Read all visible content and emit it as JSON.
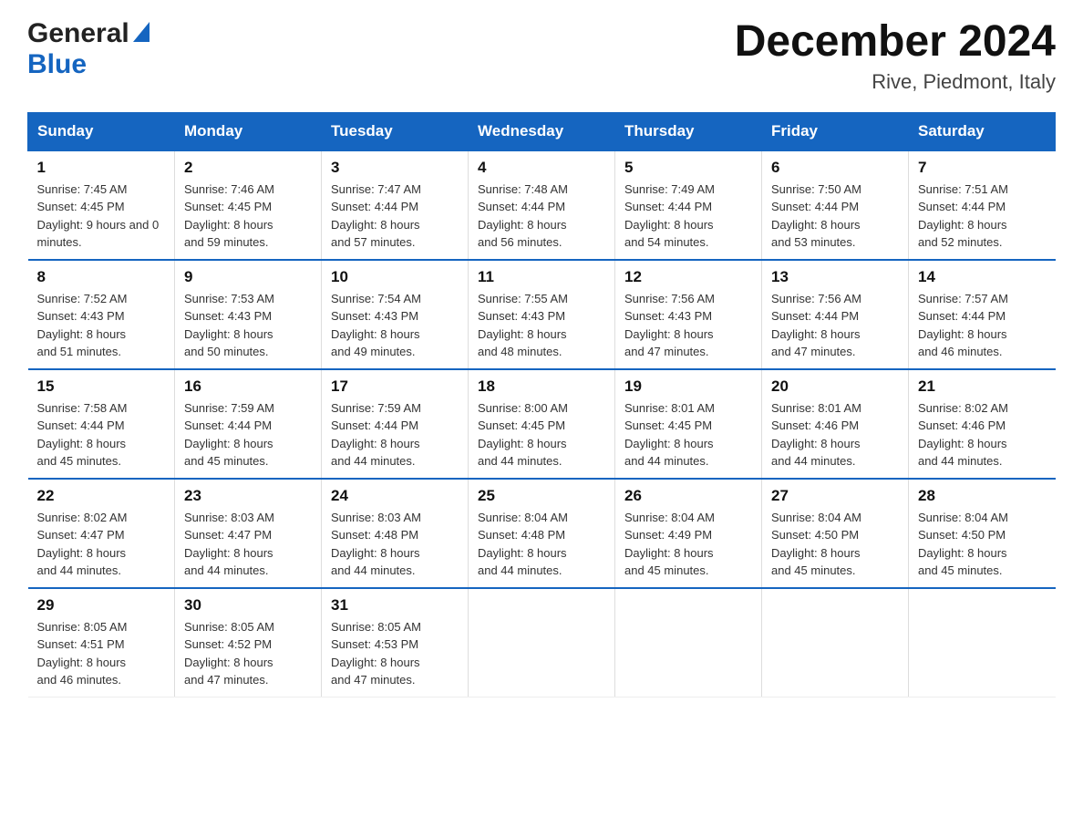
{
  "header": {
    "logo_general": "General",
    "logo_blue": "Blue",
    "month_title": "December 2024",
    "location": "Rive, Piedmont, Italy"
  },
  "days_of_week": [
    "Sunday",
    "Monday",
    "Tuesday",
    "Wednesday",
    "Thursday",
    "Friday",
    "Saturday"
  ],
  "weeks": [
    [
      {
        "day": "1",
        "sunrise": "7:45 AM",
        "sunset": "4:45 PM",
        "daylight": "9 hours and 0 minutes."
      },
      {
        "day": "2",
        "sunrise": "7:46 AM",
        "sunset": "4:45 PM",
        "daylight": "8 hours and 59 minutes."
      },
      {
        "day": "3",
        "sunrise": "7:47 AM",
        "sunset": "4:44 PM",
        "daylight": "8 hours and 57 minutes."
      },
      {
        "day": "4",
        "sunrise": "7:48 AM",
        "sunset": "4:44 PM",
        "daylight": "8 hours and 56 minutes."
      },
      {
        "day": "5",
        "sunrise": "7:49 AM",
        "sunset": "4:44 PM",
        "daylight": "8 hours and 54 minutes."
      },
      {
        "day": "6",
        "sunrise": "7:50 AM",
        "sunset": "4:44 PM",
        "daylight": "8 hours and 53 minutes."
      },
      {
        "day": "7",
        "sunrise": "7:51 AM",
        "sunset": "4:44 PM",
        "daylight": "8 hours and 52 minutes."
      }
    ],
    [
      {
        "day": "8",
        "sunrise": "7:52 AM",
        "sunset": "4:43 PM",
        "daylight": "8 hours and 51 minutes."
      },
      {
        "day": "9",
        "sunrise": "7:53 AM",
        "sunset": "4:43 PM",
        "daylight": "8 hours and 50 minutes."
      },
      {
        "day": "10",
        "sunrise": "7:54 AM",
        "sunset": "4:43 PM",
        "daylight": "8 hours and 49 minutes."
      },
      {
        "day": "11",
        "sunrise": "7:55 AM",
        "sunset": "4:43 PM",
        "daylight": "8 hours and 48 minutes."
      },
      {
        "day": "12",
        "sunrise": "7:56 AM",
        "sunset": "4:43 PM",
        "daylight": "8 hours and 47 minutes."
      },
      {
        "day": "13",
        "sunrise": "7:56 AM",
        "sunset": "4:44 PM",
        "daylight": "8 hours and 47 minutes."
      },
      {
        "day": "14",
        "sunrise": "7:57 AM",
        "sunset": "4:44 PM",
        "daylight": "8 hours and 46 minutes."
      }
    ],
    [
      {
        "day": "15",
        "sunrise": "7:58 AM",
        "sunset": "4:44 PM",
        "daylight": "8 hours and 45 minutes."
      },
      {
        "day": "16",
        "sunrise": "7:59 AM",
        "sunset": "4:44 PM",
        "daylight": "8 hours and 45 minutes."
      },
      {
        "day": "17",
        "sunrise": "7:59 AM",
        "sunset": "4:44 PM",
        "daylight": "8 hours and 44 minutes."
      },
      {
        "day": "18",
        "sunrise": "8:00 AM",
        "sunset": "4:45 PM",
        "daylight": "8 hours and 44 minutes."
      },
      {
        "day": "19",
        "sunrise": "8:01 AM",
        "sunset": "4:45 PM",
        "daylight": "8 hours and 44 minutes."
      },
      {
        "day": "20",
        "sunrise": "8:01 AM",
        "sunset": "4:46 PM",
        "daylight": "8 hours and 44 minutes."
      },
      {
        "day": "21",
        "sunrise": "8:02 AM",
        "sunset": "4:46 PM",
        "daylight": "8 hours and 44 minutes."
      }
    ],
    [
      {
        "day": "22",
        "sunrise": "8:02 AM",
        "sunset": "4:47 PM",
        "daylight": "8 hours and 44 minutes."
      },
      {
        "day": "23",
        "sunrise": "8:03 AM",
        "sunset": "4:47 PM",
        "daylight": "8 hours and 44 minutes."
      },
      {
        "day": "24",
        "sunrise": "8:03 AM",
        "sunset": "4:48 PM",
        "daylight": "8 hours and 44 minutes."
      },
      {
        "day": "25",
        "sunrise": "8:04 AM",
        "sunset": "4:48 PM",
        "daylight": "8 hours and 44 minutes."
      },
      {
        "day": "26",
        "sunrise": "8:04 AM",
        "sunset": "4:49 PM",
        "daylight": "8 hours and 45 minutes."
      },
      {
        "day": "27",
        "sunrise": "8:04 AM",
        "sunset": "4:50 PM",
        "daylight": "8 hours and 45 minutes."
      },
      {
        "day": "28",
        "sunrise": "8:04 AM",
        "sunset": "4:50 PM",
        "daylight": "8 hours and 45 minutes."
      }
    ],
    [
      {
        "day": "29",
        "sunrise": "8:05 AM",
        "sunset": "4:51 PM",
        "daylight": "8 hours and 46 minutes."
      },
      {
        "day": "30",
        "sunrise": "8:05 AM",
        "sunset": "4:52 PM",
        "daylight": "8 hours and 47 minutes."
      },
      {
        "day": "31",
        "sunrise": "8:05 AM",
        "sunset": "4:53 PM",
        "daylight": "8 hours and 47 minutes."
      },
      null,
      null,
      null,
      null
    ]
  ]
}
